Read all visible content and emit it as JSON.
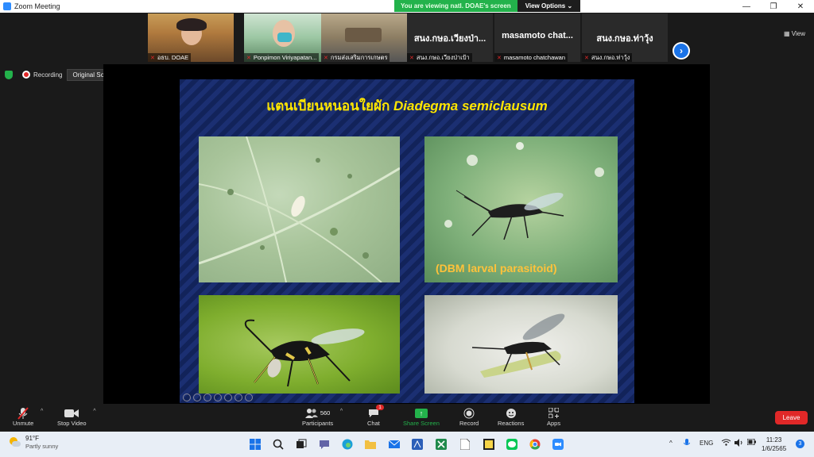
{
  "window": {
    "title": "Zoom Meeting",
    "controls": [
      "—",
      "❐",
      "✕"
    ]
  },
  "share_banner": {
    "message": "You are viewing natl. DOAE's screen",
    "view_options": "View Options ⌄"
  },
  "gallery": {
    "tiles": [
      {
        "name": "อธบ. DOAE",
        "type": "video"
      },
      {
        "name": "Ponpimon Viriyapatan...",
        "type": "video"
      },
      {
        "name": "กรมส่งเสริมการเกษตร",
        "type": "video"
      },
      {
        "name": "สนง.กษอ.เวียงป่าเป้า",
        "display": "สนง.กษอ.เวียงป่า...",
        "type": "name"
      },
      {
        "name": "masamoto chatchawan",
        "display": "masamoto chat...",
        "type": "name"
      },
      {
        "name": "สนง.กษอ.ท่าวุ้ง",
        "display": "สนง.กษอ.ท่าวุ้ง",
        "type": "name"
      }
    ],
    "next_icon": "›",
    "view_label": "View"
  },
  "recording": {
    "label": "Recording",
    "sound_button": "Original Sound: Off",
    "sound_caret": "▾"
  },
  "slide": {
    "title_thai": "แตนเบียนหนอนใยผัก",
    "title_sci": "Diadegma semiclausum",
    "photo_label": "(DBM larval parasitoid)"
  },
  "controls": {
    "unmute": "Unmute",
    "stop_video": "Stop Video",
    "participants": "Participants",
    "participants_count": "560",
    "chat": "Chat",
    "chat_badge": "1",
    "share_screen": "Share Screen",
    "record": "Record",
    "reactions": "Reactions",
    "apps": "Apps",
    "leave": "Leave"
  },
  "taskbar": {
    "temperature": "91°F",
    "condition": "Partly sunny",
    "language": "ENG",
    "time": "11:23",
    "date": "1/6/2565",
    "notification_count": "3"
  },
  "colors": {
    "accent_green": "#23b24b",
    "leave_red": "#e02828",
    "slide_title_yellow": "#ffe600",
    "label_orange": "#ffc23a"
  }
}
